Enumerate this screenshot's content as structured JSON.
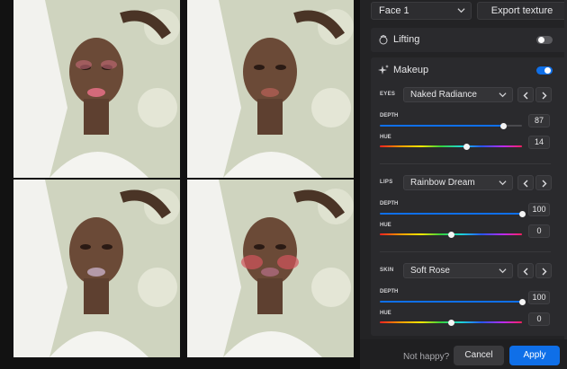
{
  "header": {
    "face_select": "Face 1",
    "export_label": "Export texture"
  },
  "lifting": {
    "label": "Lifting",
    "enabled": false
  },
  "makeup": {
    "label": "Makeup",
    "enabled": true,
    "groups": [
      {
        "label": "EYES",
        "preset": "Naked Radiance",
        "depth_label": "DEPTH",
        "depth": "87",
        "hue_label": "HUE",
        "hue": "14"
      },
      {
        "label": "LIPS",
        "preset": "Rainbow Dream",
        "depth_label": "DEPTH",
        "depth": "100",
        "hue_label": "HUE",
        "hue": "0"
      },
      {
        "label": "SKIN",
        "preset": "Soft Rose",
        "depth_label": "DEPTH",
        "depth": "100",
        "hue_label": "HUE",
        "hue": "0"
      }
    ]
  },
  "footer": {
    "prompt": "Not happy?",
    "cancel_label": "Cancel",
    "apply_label": "Apply"
  },
  "colors": {
    "accent": "#0f6fe8",
    "panel": "#232325",
    "toggle_off": "#5a5a5e"
  },
  "icons": {
    "lifting": "lift-face-icon",
    "makeup": "sparkle-icon",
    "dropdown": "chevron-down-icon",
    "prev": "chevron-left-icon",
    "next": "chevron-right-icon"
  }
}
